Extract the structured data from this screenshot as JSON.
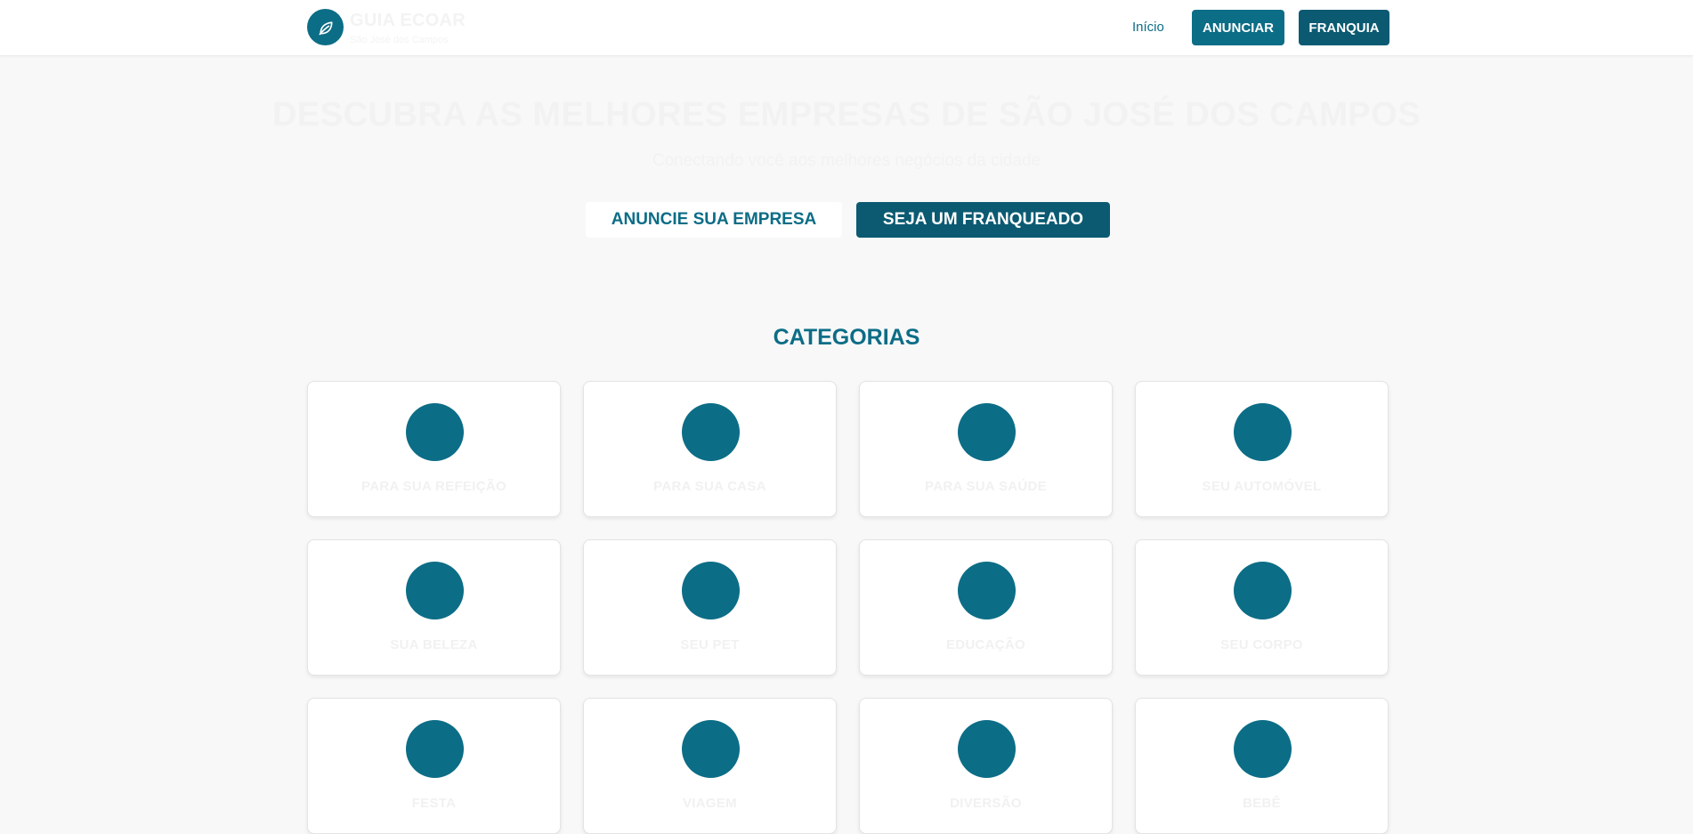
{
  "nav": {
    "logo_title": "GUIA ECOAR",
    "logo_sub": "São José dos Campos",
    "logo_icon": "leaf-icon",
    "inicio": "Início",
    "anunciar": "ANUNCIAR",
    "franquia": "FRANQUIA"
  },
  "hero": {
    "title": "DESCUBRA AS MELHORES EMPRESAS DE SÃO JOSÉ DOS CAMPOS",
    "subtitle": "Conectando você aos melhores negócios da cidade",
    "btn_announce": "ANUNCIE SUA EMPRESA",
    "btn_franchise": "SEJA UM FRANQUEADO"
  },
  "categories": {
    "title": "CATEGORIAS",
    "items": [
      {
        "label": "PARA SUA REFEIÇÃO"
      },
      {
        "label": "PARA SUA CASA"
      },
      {
        "label": "PARA SUA SAÚDE"
      },
      {
        "label": "SEU AUTOMÓVEL"
      },
      {
        "label": "SUA BELEZA"
      },
      {
        "label": "SEU PET"
      },
      {
        "label": "EDUCAÇÃO"
      },
      {
        "label": "SEU CORPO"
      },
      {
        "label": "FESTA"
      },
      {
        "label": "VIAGEM"
      },
      {
        "label": "DIVERSÃO"
      },
      {
        "label": "BEBÊ"
      }
    ]
  },
  "colors": {
    "primary": "#0c6d86",
    "primary_dark": "#0b5a72",
    "background": "#f8f8f8"
  }
}
